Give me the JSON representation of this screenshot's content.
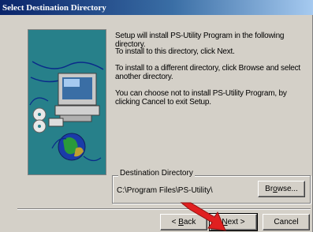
{
  "window": {
    "title": "Select Destination Directory"
  },
  "body": {
    "line1": "Setup will install PS-Utility Program in the following directory.",
    "line2": "To install to this directory, click Next.",
    "line3": "To install to a different directory, click Browse and select another directory.",
    "line4": "You can choose not to install PS-Utility Program, by clicking Cancel to exit Setup."
  },
  "destination": {
    "label": "Destination Directory",
    "path": "C:\\Program Files\\PS-Utility\\",
    "browse": {
      "mnemonic": "o",
      "pre": "Br",
      "post": "wse..."
    }
  },
  "buttons": {
    "back": {
      "pre": "< ",
      "mnemonic": "B",
      "post": "ack"
    },
    "next": {
      "pre": "",
      "mnemonic": "N",
      "post": "ext >"
    },
    "cancel": "Cancel"
  },
  "colors": {
    "accent_arrow": "#e02020",
    "art_background": "#27808a"
  }
}
